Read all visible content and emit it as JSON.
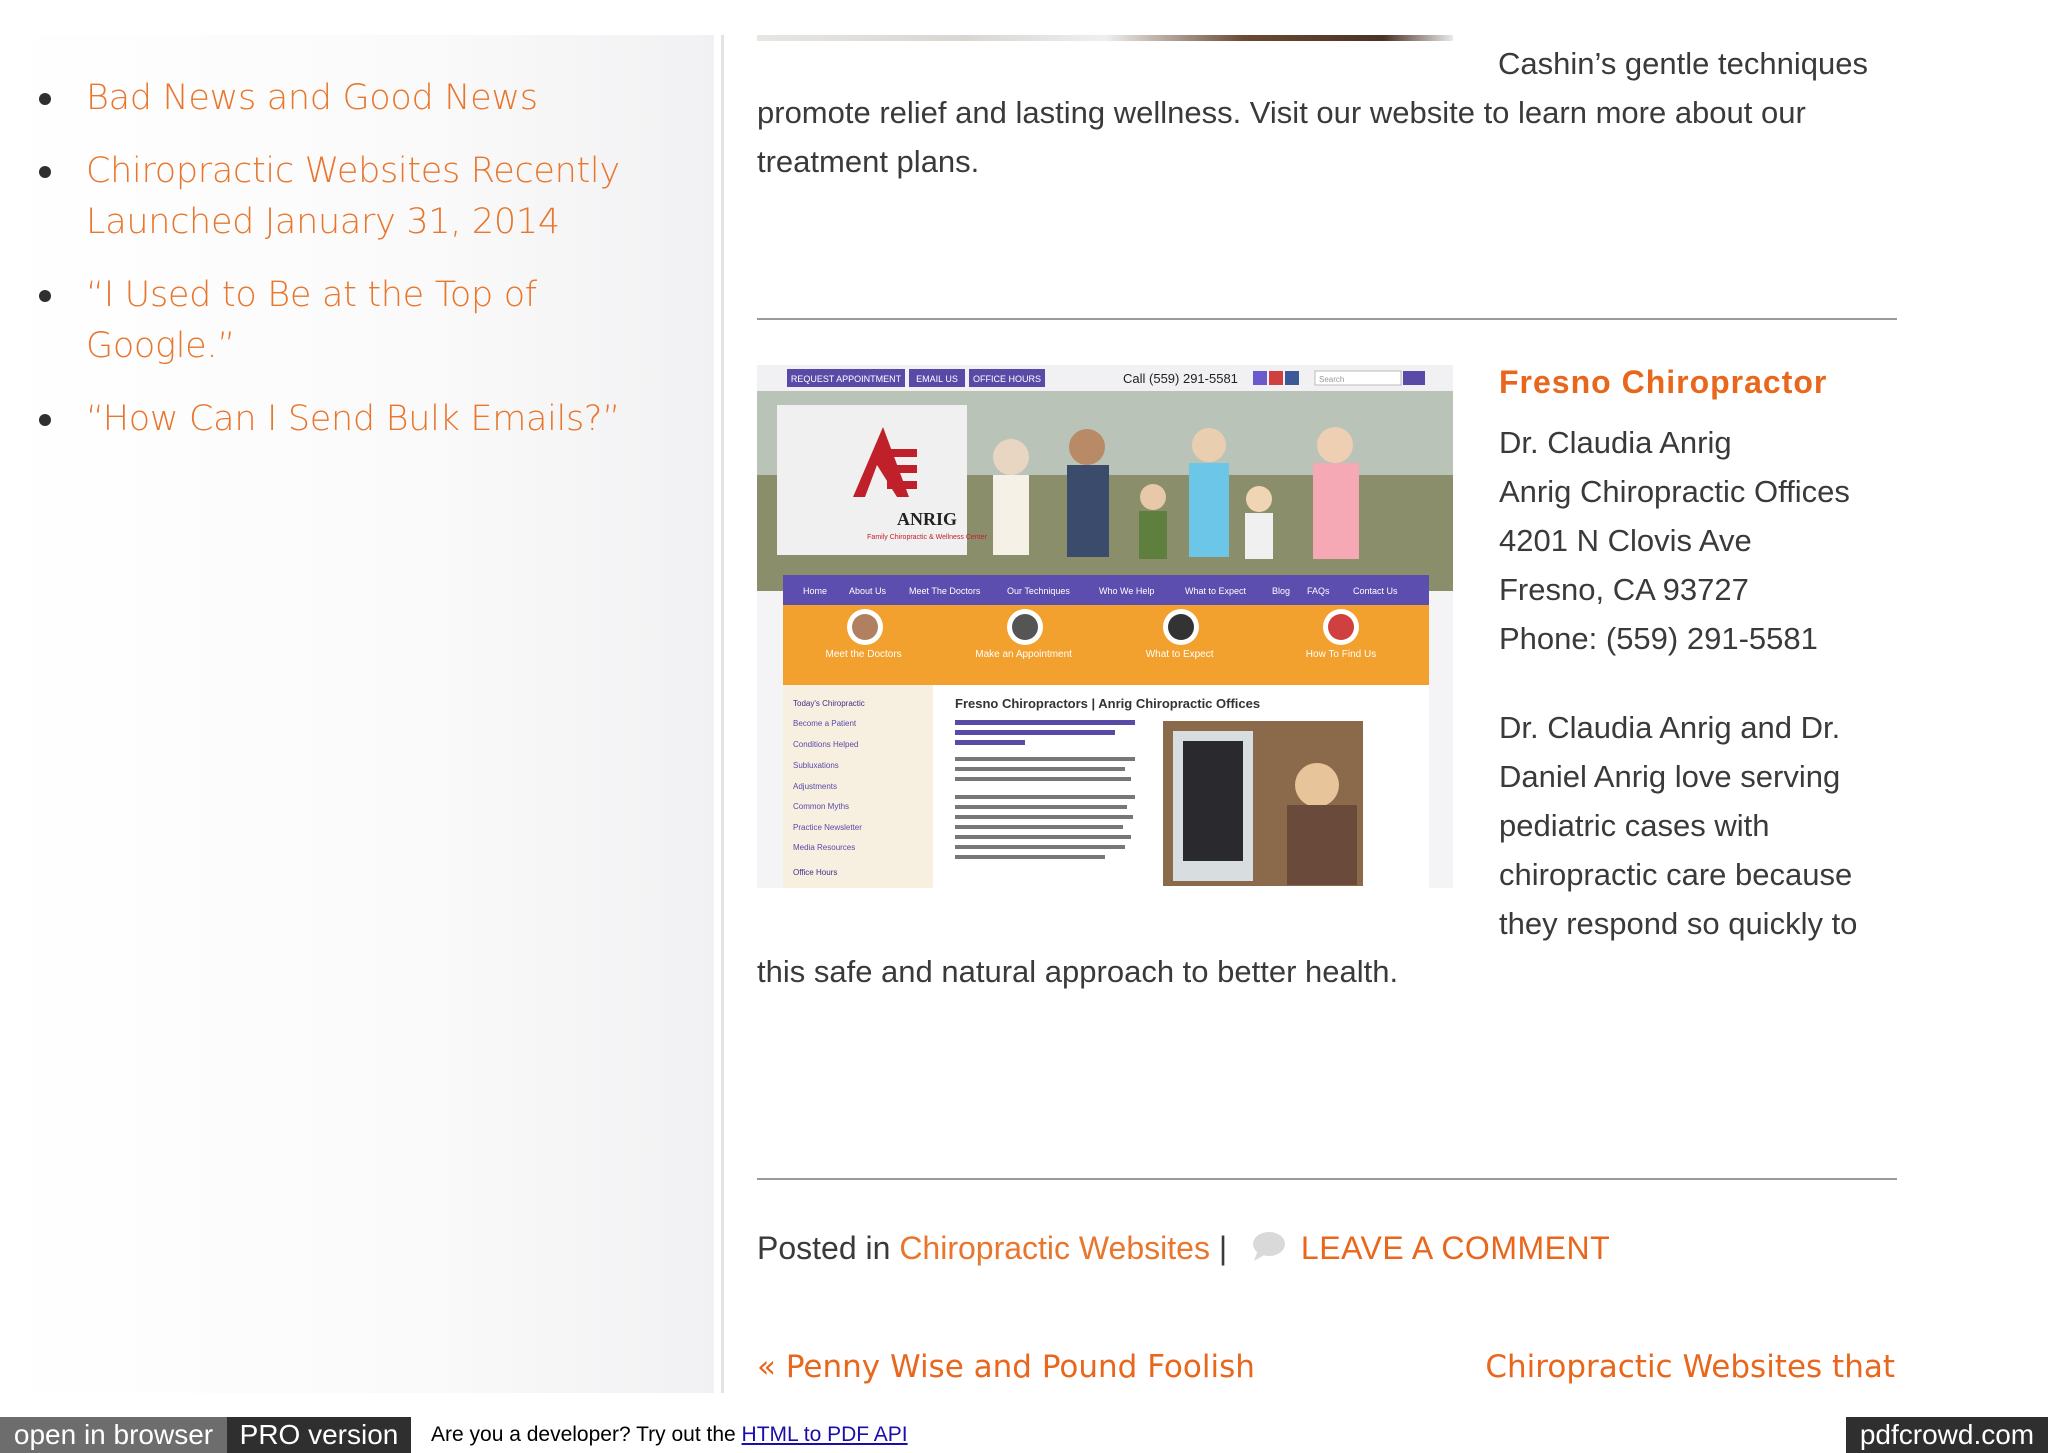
{
  "sidebar": {
    "recent_posts": [
      {
        "label": "Bad News and Good News"
      },
      {
        "label": "Chiropractic Websites Recently Launched January 31, 2014"
      },
      {
        "label": "“I Used to Be at the Top of Google.”"
      },
      {
        "label": "“How Can I Send Bulk Emails?”"
      }
    ]
  },
  "article": {
    "intro_first_line": "Cashin’s gentle techniques",
    "intro_rest": "promote relief and lasting wellness. Visit our website to learn more about our treatment plans.",
    "entry": {
      "title": "Fresno Chiropractor",
      "address_lines": [
        "Dr. Claudia Anrig",
        "Anrig Chiropractic Offices",
        "4201 N Clovis Ave",
        "Fresno, CA 93727",
        "Phone: (559) 291-5581"
      ],
      "description_wrapped": "Dr. Claudia Anrig and Dr. Daniel Anrig love serving pediatric cases with chiropractic care because they respond so quickly to",
      "description_tail": "this safe and natural approach to better health.",
      "screenshot": {
        "top_buttons": [
          "REQUEST APPOINTMENT",
          "EMAIL US",
          "OFFICE HOURS"
        ],
        "phone": "Call (559) 291-5581",
        "search_placeholder": "Search",
        "logo_text": "ANRIG",
        "logo_sub": "Family Chiropractic & Wellness Center",
        "nav_items": [
          "Home",
          "About Us",
          "Meet The Doctors",
          "Our Techniques",
          "Who We Help",
          "What to Expect",
          "Blog",
          "FAQs",
          "Contact Us"
        ],
        "feature_items": [
          "Meet the Doctors",
          "Make an Appointment",
          "What to Expect",
          "How To Find Us"
        ],
        "side_menu": [
          "Today's Chiropractic",
          "Become a Patient",
          "Conditions Helped",
          "Subluxations",
          "Adjustments",
          "Common Myths",
          "Practice Newsletter",
          "Media Resources",
          "Office Hours"
        ],
        "content_heading": "Fresno Chiropractors | Anrig Chiropractic Offices"
      }
    }
  },
  "post_meta": {
    "posted_in_label": "Posted in",
    "category": "Chiropractic Websites",
    "separator": "|",
    "comment_link": "LEAVE A COMMENT"
  },
  "post_nav": {
    "prev": "« Penny Wise and Pound Foolish",
    "next": "Chiropractic Websites that"
  },
  "pdf_bar": {
    "open_in_browser": "open in browser",
    "pro_version": "PRO version",
    "dev_prompt": "Are you a developer? Try out the",
    "api_link": "HTML to PDF API",
    "brand": "pdfcrowd.com"
  },
  "colors": {
    "link_orange": "#e8762d",
    "title_orange": "#e8671c",
    "body_text": "#3a3a3a"
  }
}
